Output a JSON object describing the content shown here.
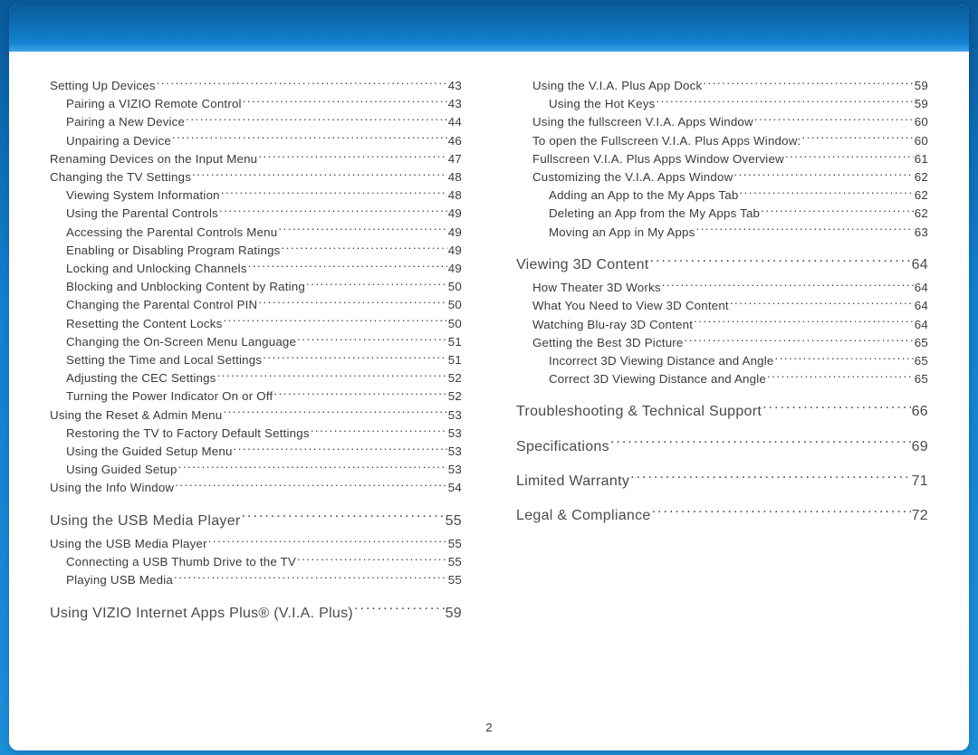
{
  "page_number": "2",
  "columns": [
    [
      {
        "label": "Setting Up Devices",
        "page": "43",
        "indent": 0,
        "section": false
      },
      {
        "label": "Pairing a VIZIO Remote Control",
        "page": "43",
        "indent": 1,
        "section": false
      },
      {
        "label": "Pairing a New Device",
        "page": "44",
        "indent": 1,
        "section": false
      },
      {
        "label": "Unpairing a Device",
        "page": "46",
        "indent": 1,
        "section": false
      },
      {
        "label": "Renaming Devices on the Input Menu",
        "page": "47",
        "indent": 0,
        "section": false
      },
      {
        "label": "Changing the TV Settings",
        "page": "48",
        "indent": 0,
        "section": false
      },
      {
        "label": "Viewing System Information",
        "page": "48",
        "indent": 1,
        "section": false
      },
      {
        "label": "Using the Parental Controls",
        "page": "49",
        "indent": 1,
        "section": false
      },
      {
        "label": "Accessing the Parental Controls Menu",
        "page": "49",
        "indent": 1,
        "section": false
      },
      {
        "label": "Enabling or Disabling Program Ratings",
        "page": "49",
        "indent": 1,
        "section": false
      },
      {
        "label": "Locking and Unlocking Channels",
        "page": "49",
        "indent": 1,
        "section": false
      },
      {
        "label": "Blocking and Unblocking Content by Rating",
        "page": "50",
        "indent": 1,
        "section": false
      },
      {
        "label": "Changing the Parental Control PIN",
        "page": "50",
        "indent": 1,
        "section": false
      },
      {
        "label": "Resetting the Content Locks",
        "page": "50",
        "indent": 1,
        "section": false
      },
      {
        "label": "Changing the On-Screen Menu Language",
        "page": "51",
        "indent": 1,
        "section": false
      },
      {
        "label": "Setting the Time and Local Settings",
        "page": "51",
        "indent": 1,
        "section": false
      },
      {
        "label": "Adjusting the CEC Settings",
        "page": "52",
        "indent": 1,
        "section": false
      },
      {
        "label": "Turning the Power Indicator On or Off",
        "page": "52",
        "indent": 1,
        "section": false
      },
      {
        "label": "Using the Reset & Admin Menu",
        "page": "53",
        "indent": 0,
        "section": false
      },
      {
        "label": "Restoring the TV to Factory Default Settings",
        "page": "53",
        "indent": 1,
        "section": false
      },
      {
        "label": "Using the Guided Setup Menu",
        "page": "53",
        "indent": 1,
        "section": false
      },
      {
        "label": "Using Guided Setup",
        "page": "53",
        "indent": 1,
        "section": false
      },
      {
        "label": "Using the Info Window",
        "page": "54",
        "indent": 0,
        "section": false
      },
      {
        "label": "Using the USB Media Player",
        "page": "55",
        "indent": 0,
        "section": true
      },
      {
        "label": "Using the USB Media Player",
        "page": "55",
        "indent": 0,
        "section": false
      },
      {
        "label": "Connecting a USB Thumb Drive to the TV",
        "page": "55",
        "indent": 1,
        "section": false
      },
      {
        "label": "Playing USB Media",
        "page": "55",
        "indent": 1,
        "section": false
      },
      {
        "label": "Using VIZIO Internet Apps Plus® (V.I.A. Plus)",
        "page": "59",
        "indent": 0,
        "section": true
      }
    ],
    [
      {
        "label": "Using the V.I.A. Plus App Dock",
        "page": "59",
        "indent": 1,
        "section": false
      },
      {
        "label": "Using the Hot Keys",
        "page": "59",
        "indent": 2,
        "section": false
      },
      {
        "label": "Using the fullscreen V.I.A. Apps Window",
        "page": "60",
        "indent": 1,
        "section": false
      },
      {
        "label": "To open the Fullscreen V.I.A. Plus Apps Window:",
        "page": "60",
        "indent": 1,
        "section": false
      },
      {
        "label": "Fullscreen V.I.A. Plus Apps Window Overview",
        "page": "61",
        "indent": 1,
        "section": false
      },
      {
        "label": "Customizing the V.I.A. Apps Window",
        "page": "62",
        "indent": 1,
        "section": false
      },
      {
        "label": "Adding an App to the My Apps Tab",
        "page": "62",
        "indent": 2,
        "section": false
      },
      {
        "label": "Deleting an App from the My Apps Tab",
        "page": "62",
        "indent": 2,
        "section": false
      },
      {
        "label": "Moving an App in My Apps",
        "page": "63",
        "indent": 2,
        "section": false
      },
      {
        "label": "Viewing 3D Content",
        "page": "64",
        "indent": 0,
        "section": true
      },
      {
        "label": "How Theater 3D Works",
        "page": "64",
        "indent": 1,
        "section": false
      },
      {
        "label": "What You Need to View 3D Content",
        "page": "64",
        "indent": 1,
        "section": false
      },
      {
        "label": "Watching Blu-ray 3D Content",
        "page": "64",
        "indent": 1,
        "section": false
      },
      {
        "label": "Getting the Best 3D Picture",
        "page": "65",
        "indent": 1,
        "section": false
      },
      {
        "label": "Incorrect 3D Viewing Distance and Angle",
        "page": "65",
        "indent": 2,
        "section": false
      },
      {
        "label": "Correct 3D Viewing Distance and Angle",
        "page": "65",
        "indent": 2,
        "section": false
      },
      {
        "label": "Troubleshooting & Technical Support",
        "page": "66",
        "indent": 0,
        "section": true
      },
      {
        "label": "Specifications",
        "page": "69",
        "indent": 0,
        "section": true
      },
      {
        "label": "Limited Warranty",
        "page": "71",
        "indent": 0,
        "section": true
      },
      {
        "label": "Legal & Compliance",
        "page": "72",
        "indent": 0,
        "section": true
      }
    ]
  ]
}
